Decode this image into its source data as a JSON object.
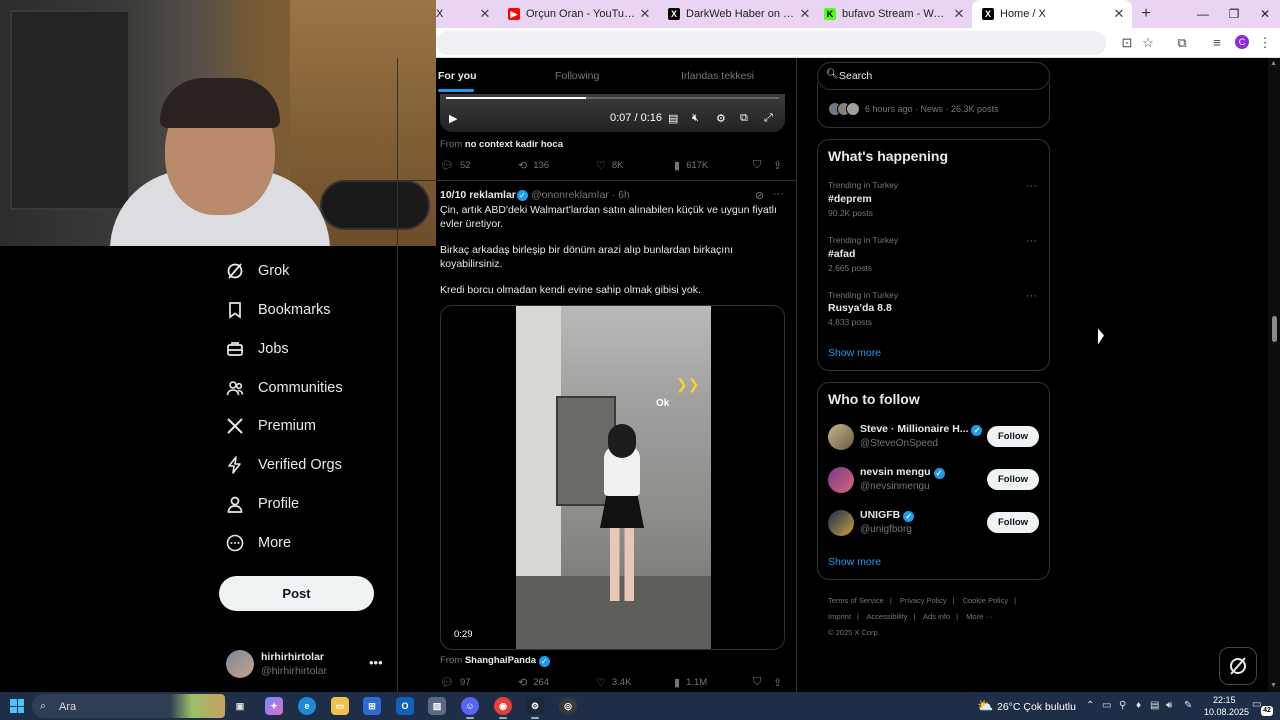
{
  "browser": {
    "tabs": [
      {
        "title": "X",
        "favicon": "x-icon"
      },
      {
        "title": "Orçun Oran - YouTube",
        "favicon": "youtube-icon"
      },
      {
        "title": "DarkWeb Haber on X: \"Bir yayın",
        "favicon": "x-icon"
      },
      {
        "title": "bufavo Stream - Watch Live on",
        "favicon": "kick-icon"
      },
      {
        "title": "Home / X",
        "favicon": "x-icon"
      }
    ],
    "profile_initial": "C"
  },
  "nav": {
    "items": [
      {
        "label": "Grok",
        "icon": "grok-icon"
      },
      {
        "label": "Bookmarks",
        "icon": "bookmark-icon"
      },
      {
        "label": "Jobs",
        "icon": "briefcase-icon"
      },
      {
        "label": "Communities",
        "icon": "people-icon"
      },
      {
        "label": "Premium",
        "icon": "x-logo-icon"
      },
      {
        "label": "Verified Orgs",
        "icon": "lightning-icon"
      },
      {
        "label": "Profile",
        "icon": "person-icon"
      },
      {
        "label": "More",
        "icon": "more-circle-icon"
      }
    ],
    "post_label": "Post",
    "account": {
      "name": "hirhirhirtolar",
      "handle": "@hirhirhirtolar"
    }
  },
  "feed": {
    "tabs": [
      "For you",
      "Following",
      "Irlandas tekkesi"
    ],
    "video1": {
      "time": "0:07 / 0:16",
      "progress": 0.42
    },
    "post1": {
      "from_prefix": "From",
      "from_name": "no context kadir hoca",
      "replies": "52",
      "reposts": "136",
      "likes": "8K",
      "views": "617K"
    },
    "post2": {
      "name": "10/10 reklamlar",
      "handle": "@ononreklamIar · 6h",
      "text1": "Çin, artık ABD'deki Walmart'lardan satın alınabilen küçük ve uygun fiyatlı evler üretiyor.",
      "text2": "Birkaç arkadaş birleşip bir dönüm arazi alıp bunlardan birkaçını koyabilirsiniz.",
      "text3": "Kredi borcu olmadan kendi evine sahip olmak gibisi yok.",
      "video_overlay": "Ok",
      "video_duration": "0:29",
      "from_prefix": "From",
      "from_name": "ShanghaiPanda",
      "replies": "97",
      "reposts": "264",
      "likes": "3.4K",
      "views": "1.1M"
    }
  },
  "sidebar": {
    "search_placeholder": "Search",
    "news_meta": "6 hours ago · News · 26.3K posts",
    "whats_happening": {
      "title": "What's happening",
      "trends": [
        {
          "context": "Trending in Turkey",
          "name": "#deprem",
          "count": "90.2K posts"
        },
        {
          "context": "Trending in Turkey",
          "name": "#afad",
          "count": "2,665 posts"
        },
        {
          "context": "Trending in Turkey",
          "name": "Rusya'da 8.8",
          "count": "4,833 posts"
        }
      ],
      "show_more": "Show more"
    },
    "who_to_follow": {
      "title": "Who to follow",
      "users": [
        {
          "name": "Steve · Millionaire H...",
          "handle": "@SteveOnSpeed",
          "button": "Follow"
        },
        {
          "name": "nevsin mengu",
          "handle": "@nevsinmengu",
          "button": "Follow"
        },
        {
          "name": "UNIGFB",
          "handle": "@unigfborg",
          "button": "Follow"
        }
      ],
      "show_more": "Show more"
    },
    "footer": {
      "links": [
        "Terms of Service",
        "|",
        "Privacy Policy",
        "|",
        "Cookie Policy",
        "|",
        "Imprint",
        "|",
        "Accessibility",
        "|",
        "Ads info",
        "|",
        "More ···"
      ],
      "copyright": "© 2025 X Corp."
    }
  },
  "taskbar": {
    "search_text": "Ara",
    "weather": "26°C  Çok bulutlu",
    "time": "22:15",
    "date": "10.08.2025",
    "notifications": "42"
  },
  "colors": {
    "accent": "#1d9bf0",
    "background": "#000000",
    "tabbar": "#e9d5f3",
    "taskbar": "#1f2e47"
  }
}
